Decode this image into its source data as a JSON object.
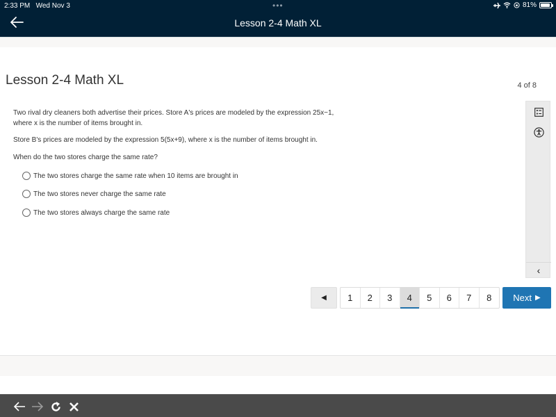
{
  "status_bar": {
    "time": "2:33 PM",
    "date": "Wed Nov 3",
    "dots": "•••",
    "battery_percent": "81%",
    "battery_level": 0.81,
    "icons": [
      "airplane-icon",
      "wifi-icon",
      "orientation-lock-icon",
      "battery-icon"
    ]
  },
  "nav": {
    "back_icon": "arrow-left-icon",
    "title": "Lesson 2-4 Math XL"
  },
  "header": {
    "title": "Lesson 2-4 Math XL",
    "page_count": "4 of 8"
  },
  "side_tools": {
    "items": [
      {
        "name": "question-list-icon"
      },
      {
        "name": "accessibility-icon"
      }
    ],
    "collapse_label": "‹"
  },
  "question": {
    "paragraphs": [
      "Two rival dry cleaners both advertise their prices. Store A's prices are modeled by the expression 25x−1, where x is the number of items brought in.",
      "Store B's prices are modeled by the expression 5(5x+9), where x is the number of items brought in.",
      "When do the two stores charge the same rate?"
    ],
    "options": [
      "The two stores charge the same rate when 10 items are brought in",
      "The two stores never charge the same rate",
      "The two stores always charge the same rate"
    ]
  },
  "pagination": {
    "prev_label": "◀",
    "pages": [
      "1",
      "2",
      "3",
      "4",
      "5",
      "6",
      "7",
      "8"
    ],
    "current": "4",
    "next_label": "Next",
    "next_icon": "▶",
    "accent": "#1f75b3"
  },
  "browser_bar": {
    "buttons": [
      "back-icon",
      "forward-icon",
      "reload-icon",
      "close-icon"
    ]
  }
}
